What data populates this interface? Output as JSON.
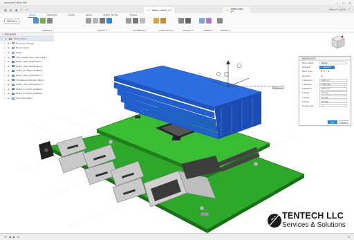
{
  "window": {
    "title": "Autodesk Fusion 360",
    "controls": [
      "—",
      "☐",
      "✕"
    ]
  },
  "tabs": {
    "active": "Jetson_carrier_v7*",
    "second": "Jetson nano v7*",
    "user": "Jetson T4 | 1H0"
  },
  "ribbon": {
    "workspace": "DESIGN ▾",
    "tabs": [
      "SOLID",
      "SURFACE",
      "FORM",
      "MESH",
      "SHEET METAL",
      "TOOLS"
    ],
    "active_tab": "SOLID",
    "groups": [
      "CREATE ▾",
      "MODIFY ▾",
      "ASSEMBLE ▾",
      "CONSTRUCT ▾",
      "INSPECT ▾",
      "INSERT ▾",
      "SELECT ▾"
    ]
  },
  "browser": {
    "header": "BROWSER",
    "items": [
      {
        "label": "Jetson carrier",
        "type": "root",
        "indent": 0
      },
      {
        "label": "Document Settings",
        "type": "doc",
        "indent": 1
      },
      {
        "label": "Named Views",
        "type": "doc",
        "indent": 1
      },
      {
        "label": "Origin",
        "type": "doc",
        "indent": 1
      },
      {
        "label": "TAS_COMB_7600_HDD_HDR:1",
        "type": "comp",
        "indent": 1
      },
      {
        "label": "PCIE1_HD3_STANDOFF:1",
        "type": "comp",
        "indent": 1
      },
      {
        "label": "PCIE1_HD3_STANDOFF:2",
        "type": "comp",
        "indent": 1
      },
      {
        "label": "PCIE1_D+STR4_SCREW:1",
        "type": "comp",
        "indent": 1
      },
      {
        "label": "PCIE1_HD3_STANDOFF:3",
        "type": "comp",
        "indent": 1
      },
      {
        "label": "JSH-EDGE-0506-002_HDR:1",
        "type": "comp",
        "indent": 1
      },
      {
        "label": "PCIE1_HD3_STANDOFF:4",
        "type": "comp",
        "indent": 1
      },
      {
        "label": "PCIE1_D+STR4_SCREW:2",
        "type": "comp",
        "indent": 1
      },
      {
        "label": "PCIE1_D+STR4_SCREW:3",
        "type": "comp",
        "indent": 1
      },
      {
        "label": "TDS-HS78-4B8:1",
        "type": "comp",
        "indent": 1
      }
    ]
  },
  "move_panel": {
    "title": "MOVE/COPY",
    "rows": [
      {
        "key": "Move Object",
        "value": "Bodies"
      },
      {
        "key": "Selection",
        "value": "1 selected",
        "selected": true
      },
      {
        "key": "Move Type",
        "value": "✥ ↻ ⤢ ⇲"
      },
      {
        "key": "Set Pivot",
        "value": "⊕"
      },
      {
        "key": "X Distance",
        "value": "0.00 mm"
      },
      {
        "key": "Y Distance",
        "value": "15.00 mm"
      },
      {
        "key": "Z Distance",
        "value": "0.00 mm"
      },
      {
        "key": "X Angle",
        "value": "0.0 deg"
      },
      {
        "key": "Y Angle",
        "value": "0.0 deg"
      },
      {
        "key": "Z Angle",
        "value": "0.0 deg"
      },
      {
        "key": "Create Copy",
        "value": "☐"
      }
    ],
    "ok": "OK",
    "cancel": "Cancel"
  },
  "viewport": {
    "distance_badge": "15.00 mm"
  },
  "timeline": {
    "controls": [
      "⏮",
      "◀",
      "▶",
      "⏭"
    ],
    "right": "⚙"
  },
  "logo": {
    "name": "TENTECH LLC",
    "tagline": "Services & Solutions"
  },
  "colors": {
    "pcb_green": "#2ea82a",
    "heatsink_blue": "#1f5fd0",
    "accent": "#0696d7"
  }
}
